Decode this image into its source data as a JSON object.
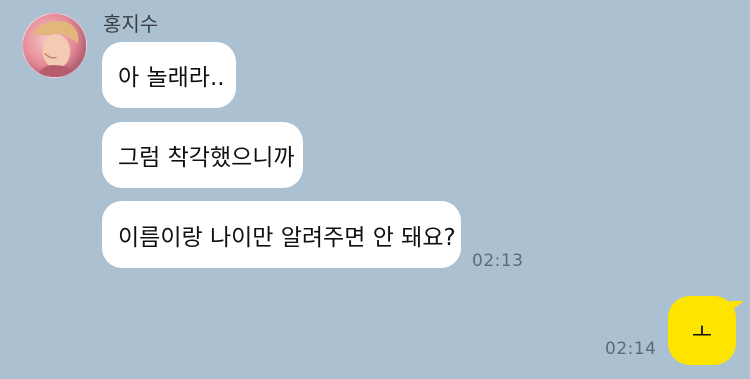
{
  "chat": {
    "sender": "홍지수",
    "messages_received": [
      {
        "text": "아 놀래라.."
      },
      {
        "text": "그럼 착각했으니까"
      },
      {
        "text": "이름이랑 나이만 알려주면 안 돼요?",
        "time": "02:13"
      }
    ],
    "messages_sent": [
      {
        "text": "ㅗ",
        "time": "02:14"
      }
    ]
  },
  "colors": {
    "background": "#abc1d1",
    "received_bubble": "#ffffff",
    "sent_bubble": "#fee500"
  },
  "icons": {
    "avatar": "profile-photo"
  }
}
